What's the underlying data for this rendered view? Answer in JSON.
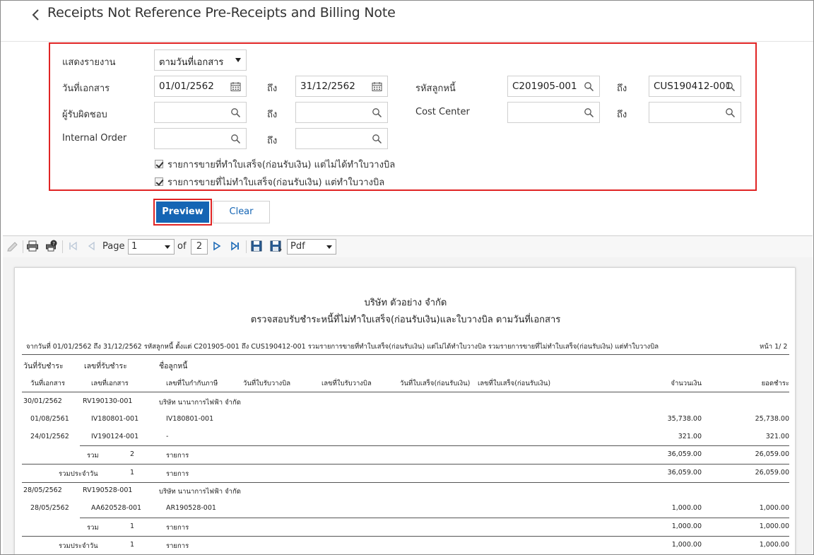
{
  "header": {
    "title": "Receipts Not Reference Pre-Receipts and Billing Note"
  },
  "filters": {
    "report_label": "แสดงรายงาน",
    "report_value": "ตามวันที่เอกสาร",
    "doc_date_label": "วันที่เอกสาร",
    "doc_date_from": "01/01/2562",
    "doc_date_to": "31/12/2562",
    "to_label": "ถึง",
    "debtor_label": "รหัสลูกหนี้",
    "debtor_from": "C201905-001",
    "debtor_to": "CUS190412-001",
    "responsible_label": "ผู้รับผิดชอบ",
    "responsible_from": "",
    "responsible_to": "",
    "cost_center_label": "Cost Center",
    "cost_center_from": "",
    "cost_center_to": "",
    "internal_order_label": "Internal Order",
    "internal_order_from": "",
    "internal_order_to": "",
    "check1": "รายการขายที่ทำใบเสร็จ(ก่อนรับเงิน) แต่ไม่ได้ทำใบวางบิล",
    "check2": "รายการขายที่ไม่ทำใบเสร็จ(ก่อนรับเงิน) แต่ทำใบวางบิล"
  },
  "buttons": {
    "preview": "Preview",
    "clear": "Clear"
  },
  "toolbar": {
    "page_label": "Page",
    "page_value": "1",
    "of_label": "of",
    "page_total": "2",
    "format": "Pdf"
  },
  "report": {
    "company": "บริษัท ตัวอย่าง จำกัด",
    "title": "ตรวจสอบรับชำระหนี้ที่ไม่ทำใบเสร็จ(ก่อนรับเงิน)และใบวางบิล ตามวันที่เอกสาร",
    "criteria": "จากวันที่ 01/01/2562 ถึง 31/12/2562 รหัสลูกหนี้ ตั้งแต่ C201905-001 ถึง CUS190412-001 รวมรายการขายที่ทำใบเสร็จ(ก่อนรับเงิน) แต่ไม่ได้ทำใบวางบิล รวมรายการขายที่ไม่ทำใบเสร็จ(ก่อนรับเงิน) แต่ทำใบวางบิล",
    "page_no": "หน้า 1/ 2",
    "col_receive_date": "วันที่รับชำระ",
    "col_receive_no": "เลขที่รับชำระ",
    "col_debtor_name": "ชื่อลูกหนี้",
    "col_doc_date": "วันที่เอกสาร",
    "col_doc_no": "เลขที่เอกสาร",
    "col_tax_invoice": "เลขที่ใบกำกับภาษี",
    "col_billing_date": "วันที่ใบรับวางบิล",
    "col_billing_no": "เลขที่ใบรับวางบิล",
    "col_receipt_date": "วันที่ใบเสร็จ(ก่อนรับเงิน)",
    "col_receipt_no": "เลขที่ใบเสร็จ(ก่อนรับเงิน)",
    "col_amount": "จำนวนเงิน",
    "col_paid": "ยอดชำระ",
    "g1_date": "30/01/2562",
    "g1_no": "RV190130-001",
    "g1_name": "บริษัท นานาการไฟฟ้า จำกัด",
    "g1_r1_date": "01/08/2561",
    "g1_r1_doc": "IV180801-001",
    "g1_r1_tax": "IV180801-001",
    "g1_r1_amount": "35,738.00",
    "g1_r1_paid": "25,738.00",
    "g1_r2_date": "24/01/2562",
    "g1_r2_doc": "IV190124-001",
    "g1_r2_tax": "-",
    "g1_r2_amount": "321.00",
    "g1_r2_paid": "321.00",
    "total_label": "รวม",
    "items_label": "รายการ",
    "daily_label": "รวมประจำวัน",
    "g1_total_count": "2",
    "g1_total_amount": "36,059.00",
    "g1_total_paid": "26,059.00",
    "g1_daily_count": "1",
    "g1_daily_amount": "36,059.00",
    "g1_daily_paid": "26,059.00",
    "g2_date": "28/05/2562",
    "g2_no": "RV190528-001",
    "g2_name": "บริษัท นานาการไฟฟ้า จำกัด",
    "g2_r1_date": "28/05/2562",
    "g2_r1_doc": "AA620528-001",
    "g2_r1_tax": "AR190528-001",
    "g2_r1_amount": "1,000.00",
    "g2_r1_paid": "1,000.00",
    "g2_total_count": "1",
    "g2_total_amount": "1,000.00",
    "g2_total_paid": "1,000.00",
    "g2_daily_count": "1",
    "g2_daily_amount": "1,000.00",
    "g2_daily_paid": "1,000.00"
  }
}
